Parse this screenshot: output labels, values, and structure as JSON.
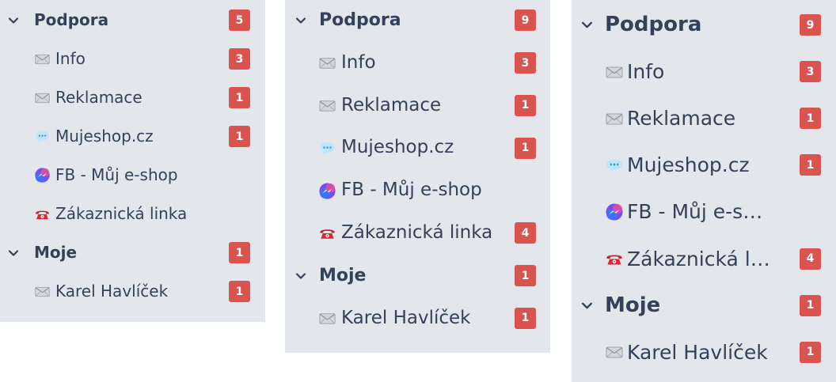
{
  "colors": {
    "panel_bg": "#e3e7eb",
    "text": "#33425a",
    "badge_bg": "#d9534f",
    "badge_text": "#ffffff"
  },
  "panels": [
    {
      "groups": [
        {
          "label": "Podpora",
          "count": "5",
          "items": [
            {
              "icon": "envelope-icon",
              "label": "Info",
              "count": "3"
            },
            {
              "icon": "envelope-icon",
              "label": "Reklamace",
              "count": "1"
            },
            {
              "icon": "chat-bubble-icon",
              "label": "Mujeshop.cz",
              "count": "1"
            },
            {
              "icon": "messenger-icon",
              "label": "FB - Můj e-shop",
              "count": ""
            },
            {
              "icon": "telephone-icon",
              "label": "Zákaznická linka",
              "count": ""
            }
          ]
        },
        {
          "label": "Moje",
          "count": "1",
          "items": [
            {
              "icon": "envelope-icon",
              "label": "Karel Havlíček",
              "count": "1"
            }
          ]
        }
      ]
    },
    {
      "groups": [
        {
          "label": "Podpora",
          "count": "9",
          "items": [
            {
              "icon": "envelope-icon",
              "label": "Info",
              "count": "3"
            },
            {
              "icon": "envelope-icon",
              "label": "Reklamace",
              "count": "1"
            },
            {
              "icon": "chat-bubble-icon",
              "label": "Mujeshop.cz",
              "count": "1"
            },
            {
              "icon": "messenger-icon",
              "label": "FB - Můj e-shop",
              "count": ""
            },
            {
              "icon": "telephone-icon",
              "label": "Zákaznická linka",
              "count": "4"
            }
          ]
        },
        {
          "label": "Moje",
          "count": "1",
          "items": [
            {
              "icon": "envelope-icon",
              "label": "Karel Havlíček",
              "count": "1"
            }
          ]
        }
      ]
    },
    {
      "groups": [
        {
          "label": "Podpora",
          "count": "9",
          "items": [
            {
              "icon": "envelope-icon",
              "label": "Info",
              "count": "3"
            },
            {
              "icon": "envelope-icon",
              "label": "Reklamace",
              "count": "1"
            },
            {
              "icon": "chat-bubble-icon",
              "label": "Mujeshop.cz",
              "count": "1"
            },
            {
              "icon": "messenger-icon",
              "label": "FB - Můj e-shop",
              "count": ""
            },
            {
              "icon": "telephone-icon",
              "label": "Zákaznická linka",
              "count": "4"
            }
          ]
        },
        {
          "label": "Moje",
          "count": "1",
          "items": [
            {
              "icon": "envelope-icon",
              "label": "Karel Havlíček",
              "count": "1"
            }
          ]
        }
      ]
    }
  ]
}
